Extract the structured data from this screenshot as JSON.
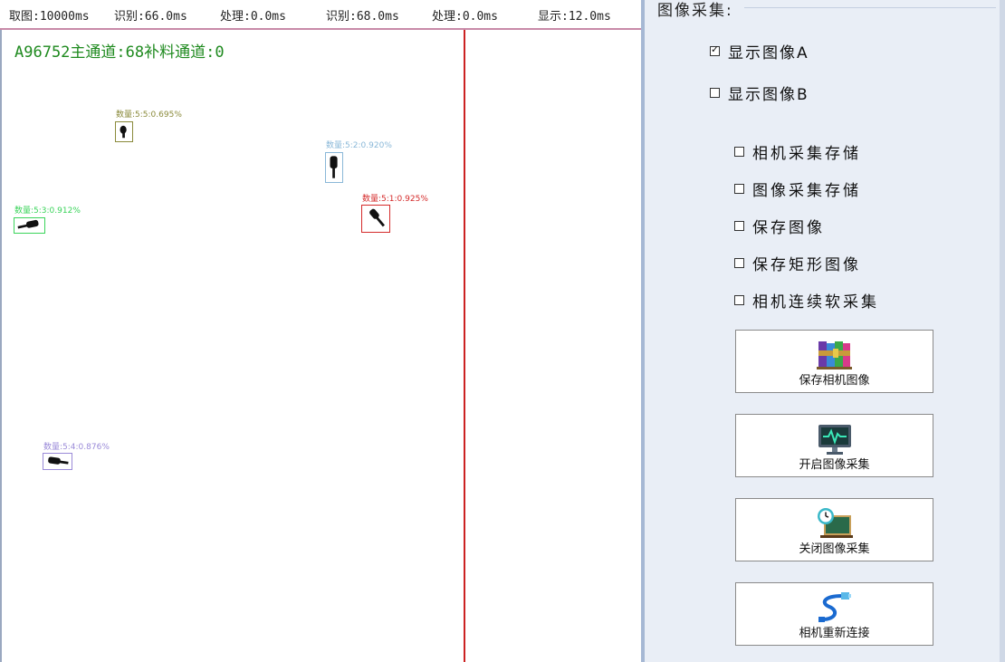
{
  "status": {
    "capture": "取图:10000ms",
    "recog1": "识别:66.0ms",
    "proc1": "处理:0.0ms",
    "recog2": "识别:68.0ms",
    "proc2": "处理:0.0ms",
    "display": "显示:12.0ms"
  },
  "viewer": {
    "channel_title": "A96752主通道:68补料通道:0",
    "detections": [
      {
        "label": "数量:5:5:0.695%",
        "color": "#8a8a3a"
      },
      {
        "label": "数量:5:2:0.920%",
        "color": "#8ab8d8"
      },
      {
        "label": "数量:5:1:0.925%",
        "color": "#d42a2a"
      },
      {
        "label": "数量:5:3:0.912%",
        "color": "#3ad45a"
      },
      {
        "label": "数量:5:4:0.876%",
        "color": "#9a8ad8"
      }
    ]
  },
  "panel": {
    "group_title": "图像采集:",
    "show_a": {
      "label": "显示图像A",
      "checked": true
    },
    "show_b": {
      "label": "显示图像B",
      "checked": false
    },
    "options": [
      {
        "label": "相机采集存储",
        "checked": false
      },
      {
        "label": "图像采集存储",
        "checked": false
      },
      {
        "label": "保存图像",
        "checked": false
      },
      {
        "label": "保存矩形图像",
        "checked": false
      },
      {
        "label": "相机连续软采集",
        "checked": false
      }
    ],
    "buttons": [
      {
        "label": "保存相机图像",
        "icon": "archive-books-icon"
      },
      {
        "label": "开启图像采集",
        "icon": "monitor-pulse-icon"
      },
      {
        "label": "关闭图像采集",
        "icon": "clock-board-icon"
      },
      {
        "label": "相机重新连接",
        "icon": "network-cable-icon"
      }
    ]
  }
}
